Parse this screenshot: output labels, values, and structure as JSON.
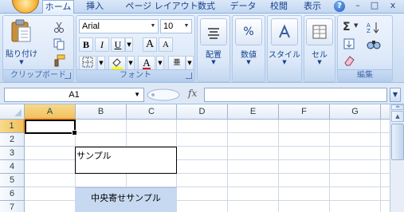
{
  "tabs": [
    "ホーム",
    "挿入",
    "ページ レイアウト",
    "数式",
    "データ",
    "校閲",
    "表示"
  ],
  "window_buttons": {
    "help": "?",
    "minimize": "–",
    "restore": "□",
    "close": "x"
  },
  "clipboard": {
    "paste_label": "貼り付け",
    "group_label": "クリップボード"
  },
  "font": {
    "font_name": "Arial",
    "font_size": "10",
    "bold": "B",
    "italic": "I",
    "underline": "U",
    "grow": "A",
    "shrink": "A",
    "font_color_letter": "A",
    "phonetic": "亜",
    "group_label": "フォント"
  },
  "alignment": {
    "label": "配置"
  },
  "number": {
    "label": "数値",
    "symbol": "%"
  },
  "styles": {
    "label": "スタイル"
  },
  "cells": {
    "label": "セル"
  },
  "editing": {
    "label": "編集",
    "sum": "Σ"
  },
  "formula_bar": {
    "name_box": "A1",
    "fx": "fx",
    "formula": ""
  },
  "columns": [
    "A",
    "B",
    "C",
    "D",
    "E",
    "F",
    "G"
  ],
  "rows": [
    "1",
    "2",
    "3",
    "4",
    "5",
    "6",
    "7"
  ],
  "cells_content": {
    "B3": "サンプル",
    "B6": "中央寄せサンプル"
  },
  "colors": {
    "accent": "#15428b",
    "selected_header": "#f1c15f",
    "centered_cell_fill": "#c6d9f1"
  }
}
